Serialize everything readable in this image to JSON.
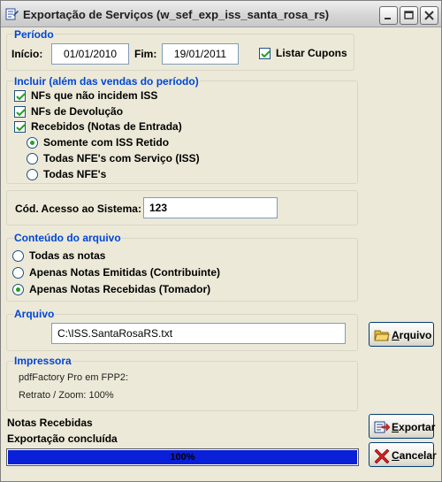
{
  "window": {
    "title": "Exportação de Serviços (w_sef_exp_iss_santa_rosa_rs)"
  },
  "periodo": {
    "label": "Período",
    "inicio_label": "Início:",
    "inicio_value": "01/01/2010",
    "fim_label": "Fim:",
    "fim_value": "19/01/2011",
    "listar_cupons_label": "Listar Cupons",
    "listar_cupons_checked": true
  },
  "incluir": {
    "label": "Incluir (além das vendas do período)",
    "checkboxes": [
      {
        "label": "NFs que não incidem ISS",
        "checked": true
      },
      {
        "label": "NFs de Devolução",
        "checked": true
      },
      {
        "label": "Recebidos (Notas de Entrada)",
        "checked": true
      }
    ],
    "radios": [
      {
        "label": "Somente com ISS Retido",
        "selected": true
      },
      {
        "label": "Todas NFE's com Serviço (ISS)",
        "selected": false
      },
      {
        "label": "Todas NFE's",
        "selected": false
      }
    ]
  },
  "acesso": {
    "label": "Cód. Acesso ao Sistema:",
    "value": "123"
  },
  "conteudo": {
    "label": "Conteúdo do arquivo",
    "radios": [
      {
        "label": "Todas as notas",
        "selected": false
      },
      {
        "label": "Apenas Notas Emitidas (Contribuinte)",
        "selected": false
      },
      {
        "label": "Apenas Notas Recebidas (Tomador)",
        "selected": true
      }
    ]
  },
  "arquivo": {
    "label": "Arquivo",
    "value": "C:\\ISS.SantaRosaRS.txt",
    "button_label": "Arquivo",
    "button_accel": "A"
  },
  "impressora": {
    "label": "Impressora",
    "printer": "pdfFactory Pro em FPP2:",
    "settings": "Retrato / Zoom: 100%"
  },
  "status": {
    "line1": "Notas Recebidas",
    "line2": "Exportação concluída",
    "progress_text": "100%",
    "progress_fraction": 1.0
  },
  "buttons": {
    "exportar_label": "Exportar",
    "exportar_accel": "E",
    "cancelar_label": "Cancelar",
    "cancelar_accel": "C"
  },
  "colors": {
    "group_label": "#0046D5",
    "progress_fill": "#0A1FD8",
    "radio_dot": "#21A121",
    "check_mark": "#21A121"
  }
}
